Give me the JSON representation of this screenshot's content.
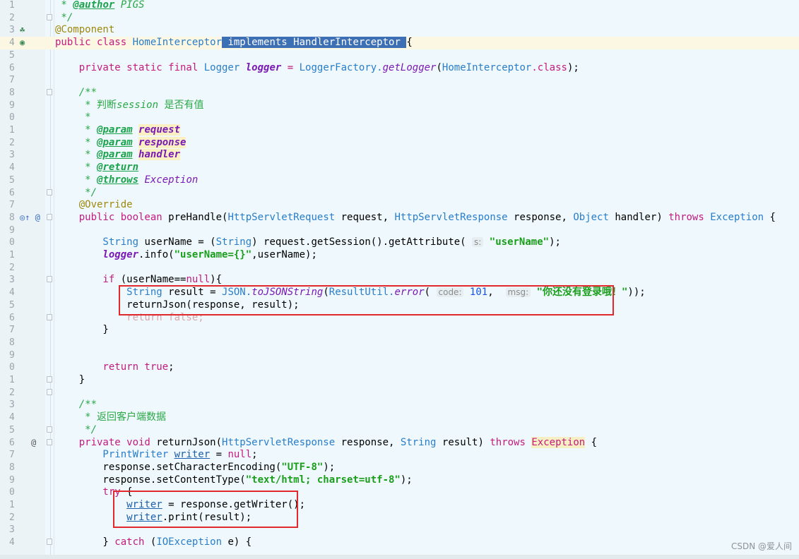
{
  "lines": [
    {
      "n": "1",
      "t": [
        [
          "cm",
          " * "
        ],
        [
          "tag",
          "@author"
        ],
        [
          "cm",
          " PIGS"
        ]
      ]
    },
    {
      "n": "2",
      "t": [
        [
          "cm",
          " */"
        ]
      ]
    },
    {
      "n": "3",
      "t": [
        [
          "ann",
          "@Component"
        ]
      ]
    },
    {
      "n": "4",
      "t": [
        [
          "kw",
          "public class "
        ],
        [
          "ty",
          "HomeInterceptor"
        ],
        [
          "sel",
          " implements HandlerInterceptor "
        ],
        [
          "",
          "{"
        ]
      ]
    },
    {
      "n": "5",
      "t": []
    },
    {
      "n": "6",
      "t": [
        [
          "kw",
          "    private static final "
        ],
        [
          "ty",
          "Logger "
        ],
        [
          "fld",
          "logger"
        ],
        [
          "kw",
          " = "
        ],
        [
          "ty",
          "LoggerFactory."
        ],
        [
          "mth",
          "getLogger"
        ],
        [
          "",
          "("
        ],
        [
          "ty",
          "HomeInterceptor"
        ],
        [
          "kw",
          ".class"
        ],
        [
          "",
          ");"
        ]
      ]
    },
    {
      "n": "7",
      "t": []
    },
    {
      "n": "8",
      "t": [
        [
          "cm",
          "    /**"
        ]
      ]
    },
    {
      "n": "9",
      "t": [
        [
          "cm",
          "     * "
        ],
        [
          "cmt",
          "判断"
        ],
        [
          "cm",
          "session "
        ],
        [
          "cmt",
          "是否有值"
        ]
      ]
    },
    {
      "n": "0",
      "t": [
        [
          "cm",
          "     *"
        ]
      ]
    },
    {
      "n": "1",
      "t": [
        [
          "cm",
          "     * "
        ],
        [
          "tag",
          "@param"
        ],
        [
          "cm",
          " "
        ],
        [
          "prm",
          "request"
        ]
      ]
    },
    {
      "n": "2",
      "t": [
        [
          "cm",
          "     * "
        ],
        [
          "tag",
          "@param"
        ],
        [
          "cm",
          " "
        ],
        [
          "prm",
          "response"
        ]
      ]
    },
    {
      "n": "3",
      "t": [
        [
          "cm",
          "     * "
        ],
        [
          "tag",
          "@param"
        ],
        [
          "cm",
          " "
        ],
        [
          "prm",
          "handler"
        ]
      ]
    },
    {
      "n": "4",
      "t": [
        [
          "cm",
          "     * "
        ],
        [
          "tag",
          "@return"
        ]
      ]
    },
    {
      "n": "5",
      "t": [
        [
          "cm",
          "     * "
        ],
        [
          "tag",
          "@throws"
        ],
        [
          "cm",
          " "
        ],
        [
          "ex",
          "Exception"
        ]
      ]
    },
    {
      "n": "6",
      "t": [
        [
          "cm",
          "     */"
        ]
      ]
    },
    {
      "n": "7",
      "t": [
        [
          "ann",
          "    @Override"
        ]
      ]
    },
    {
      "n": "8",
      "t": [
        [
          "kw",
          "    public boolean "
        ],
        [
          "",
          "preHandle("
        ],
        [
          "ty",
          "HttpServletRequest "
        ],
        [
          "",
          "request, "
        ],
        [
          "ty",
          "HttpServletResponse "
        ],
        [
          "",
          "response, "
        ],
        [
          "ty",
          "Object "
        ],
        [
          "",
          "handler) "
        ],
        [
          "kw",
          "throws "
        ],
        [
          "ty",
          "Exception "
        ],
        [
          "",
          "{"
        ]
      ]
    },
    {
      "n": "9",
      "t": []
    },
    {
      "n": "0",
      "t": [
        [
          "ty",
          "        String "
        ],
        [
          "",
          "userName = ("
        ],
        [
          "ty",
          "String"
        ],
        [
          "",
          ") request.getSession().getAttribute( "
        ],
        [
          "hint",
          "s:"
        ],
        [
          "",
          " "
        ],
        [
          "str",
          "\"userName\""
        ],
        [
          "",
          ");"
        ]
      ]
    },
    {
      "n": "1",
      "t": [
        [
          "fld",
          "        logger"
        ],
        [
          "",
          ".info("
        ],
        [
          "str",
          "\"userName={}\""
        ],
        [
          "",
          ",userName);"
        ]
      ]
    },
    {
      "n": "2",
      "t": []
    },
    {
      "n": "3",
      "t": [
        [
          "kw",
          "        if "
        ],
        [
          "",
          "(userName=="
        ],
        [
          "kw",
          "null"
        ],
        [
          "",
          "){"
        ]
      ]
    },
    {
      "n": "4",
      "t": [
        [
          "ty",
          "            String "
        ],
        [
          "",
          "result = "
        ],
        [
          "ty",
          "JSON."
        ],
        [
          "mth",
          "toJSONString"
        ],
        [
          "",
          "("
        ],
        [
          "ty",
          "ResultUtil."
        ],
        [
          "mth",
          "error"
        ],
        [
          "",
          "( "
        ],
        [
          "hint",
          "code:"
        ],
        [
          "",
          " "
        ],
        [
          "num",
          "101"
        ],
        [
          "",
          ",  "
        ],
        [
          "hint",
          "msg:"
        ],
        [
          "",
          " "
        ],
        [
          "str",
          "\"你还没有登录哦！\""
        ],
        [
          "",
          "));"
        ]
      ]
    },
    {
      "n": "5",
      "t": [
        [
          "",
          "            returnJson(response, result);"
        ]
      ]
    },
    {
      "n": "6",
      "t": [
        [
          "dim",
          "            return false;"
        ]
      ]
    },
    {
      "n": "7",
      "t": [
        [
          "",
          "        }"
        ]
      ]
    },
    {
      "n": "8",
      "t": []
    },
    {
      "n": "9",
      "t": []
    },
    {
      "n": "0",
      "t": [
        [
          "kw",
          "        return true"
        ],
        [
          "",
          ";"
        ]
      ]
    },
    {
      "n": "1",
      "t": [
        [
          "",
          "    }"
        ]
      ]
    },
    {
      "n": "2",
      "t": []
    },
    {
      "n": "3",
      "t": [
        [
          "cm",
          "    /**"
        ]
      ]
    },
    {
      "n": "4",
      "t": [
        [
          "cm",
          "     * "
        ],
        [
          "cmt",
          "返回客户端数据"
        ]
      ]
    },
    {
      "n": "5",
      "t": [
        [
          "cm",
          "     */"
        ]
      ]
    },
    {
      "n": "6",
      "t": [
        [
          "kw",
          "    private void "
        ],
        [
          "",
          "returnJson("
        ],
        [
          "ty",
          "HttpServletResponse "
        ],
        [
          "",
          "response, "
        ],
        [
          "ty",
          "String "
        ],
        [
          "",
          "result) "
        ],
        [
          "kw",
          "throws "
        ],
        [
          "exhl",
          "Exception"
        ],
        [
          "",
          " {"
        ]
      ]
    },
    {
      "n": "7",
      "t": [
        [
          "ty",
          "        PrintWriter "
        ],
        [
          "var",
          "writer"
        ],
        [
          "",
          " = "
        ],
        [
          "kw",
          "null"
        ],
        [
          "",
          ";"
        ]
      ]
    },
    {
      "n": "8",
      "t": [
        [
          "",
          "        response.setCharacterEncoding("
        ],
        [
          "str",
          "\"UTF-8\""
        ],
        [
          "",
          ");"
        ]
      ]
    },
    {
      "n": "9",
      "t": [
        [
          "",
          "        response.setContentType("
        ],
        [
          "str",
          "\"text/html; charset=utf-8\""
        ],
        [
          "",
          ");"
        ]
      ]
    },
    {
      "n": "0",
      "t": [
        [
          "kw",
          "        try "
        ],
        [
          "",
          "{"
        ]
      ]
    },
    {
      "n": "1",
      "t": [
        [
          "",
          "            "
        ],
        [
          "var",
          "writer"
        ],
        [
          "",
          " = response.getWriter();"
        ]
      ]
    },
    {
      "n": "2",
      "t": [
        [
          "",
          "            "
        ],
        [
          "var",
          "writer"
        ],
        [
          "",
          ".print(result);"
        ]
      ]
    },
    {
      "n": "3",
      "t": []
    },
    {
      "n": "4",
      "t": [
        [
          "",
          "        } "
        ],
        [
          "kw",
          "catch "
        ],
        [
          "",
          "("
        ],
        [
          "ty",
          "IOException "
        ],
        [
          "",
          "e) {"
        ]
      ]
    }
  ],
  "watermark": "CSDN @爱人间"
}
